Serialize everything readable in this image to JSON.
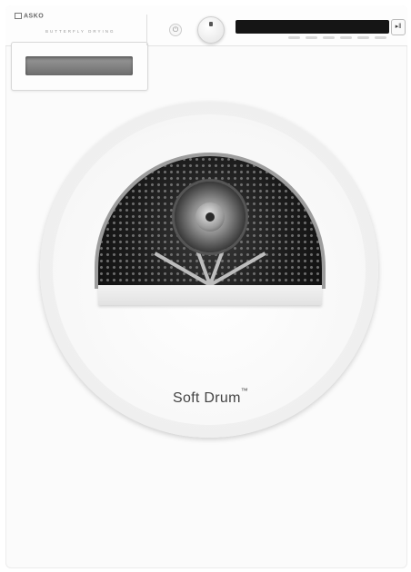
{
  "control_panel": {
    "brand_logo": "ASKO",
    "tagline": "BUTTERFLY DRYING",
    "power_icon": "power-icon",
    "program_knob_icon": "dial-icon",
    "pause_icon": "play-pause-icon"
  },
  "door": {
    "label": "Soft Drum",
    "trademark": "™"
  },
  "colors": {
    "body": "#fbfbfb",
    "display": "#151515",
    "drum": "#1b1b1b",
    "rim": "#9d9d9d"
  }
}
